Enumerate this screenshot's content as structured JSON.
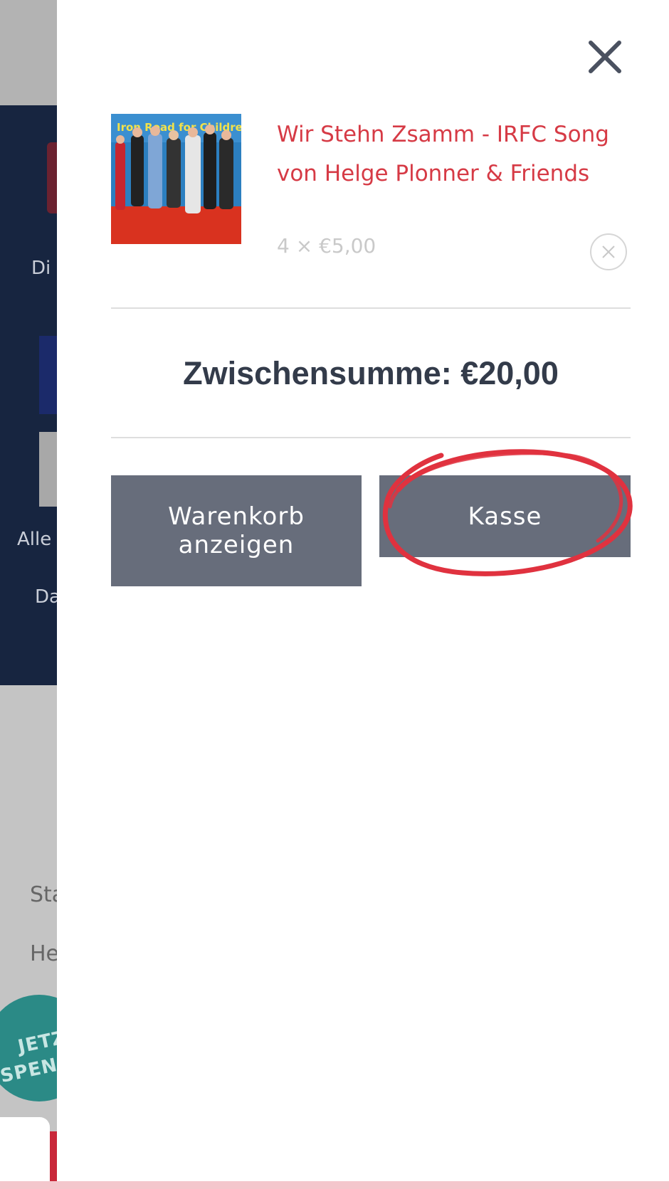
{
  "background": {
    "texts": [
      "Di",
      "Alle",
      "Da",
      "Sta",
      "He"
    ],
    "badge": [
      "JETZ",
      "SPEN"
    ]
  },
  "cart": {
    "item": {
      "title": "Wir Stehn Zsamm - IRFC Song von Helge Plonner & Friends",
      "quantity_price": "4 × €5,00",
      "image_banner_text": "Iron Road for Children"
    },
    "subtotal_text": "Zwischensumme: €20,00",
    "view_cart_label": "Warenkorb anzeigen",
    "checkout_label": "Kasse"
  },
  "colors": {
    "title_red": "#d63a45",
    "button_grey": "#676d7b",
    "annotation_red": "#e0323f",
    "navy": "#172540"
  },
  "icons": {
    "close": "close-icon",
    "remove": "remove-item-icon"
  }
}
